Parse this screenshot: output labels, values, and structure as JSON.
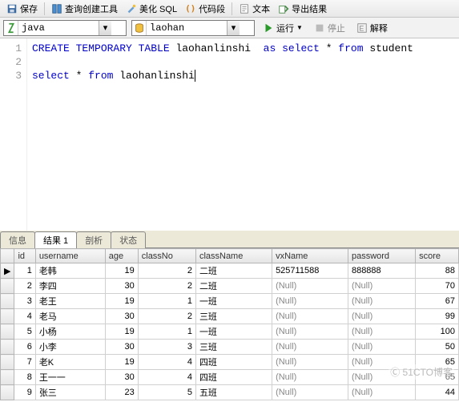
{
  "toolbar": {
    "save": "保存",
    "query_builder": "查询创建工具",
    "beautify": "美化 SQL",
    "snippet": "代码段",
    "text": "文本",
    "export": "导出结果"
  },
  "selectors": {
    "conn": "java",
    "db": "laohan",
    "run": "运行",
    "stop": "停止",
    "explain": "解释"
  },
  "code": {
    "lines": [
      {
        "n": "1",
        "parts": [
          {
            "t": "CREATE TEMPORARY TABLE",
            "c": "kw"
          },
          {
            "t": " laohanlinshi  ",
            "c": "id"
          },
          {
            "t": "as select",
            "c": "kw"
          },
          {
            "t": " * ",
            "c": "id"
          },
          {
            "t": "from",
            "c": "kw"
          },
          {
            "t": " student",
            "c": "id"
          }
        ]
      },
      {
        "n": "2",
        "parts": []
      },
      {
        "n": "3",
        "parts": [
          {
            "t": "select",
            "c": "kw"
          },
          {
            "t": " * ",
            "c": "id"
          },
          {
            "t": "from",
            "c": "kw"
          },
          {
            "t": " laohanlinshi",
            "c": "id"
          }
        ],
        "cursor": true
      }
    ]
  },
  "tabs": {
    "info": "信息",
    "result": "结果 1",
    "profile": "剖析",
    "status": "状态"
  },
  "grid": {
    "headers": [
      "id",
      "username",
      "age",
      "classNo",
      "className",
      "vxName",
      "password",
      "score"
    ],
    "rows": [
      {
        "id": 1,
        "username": "老韩",
        "age": 19,
        "classNo": 2,
        "className": "二班",
        "vxName": "525711588",
        "password": "888888",
        "score": 88
      },
      {
        "id": 2,
        "username": "李四",
        "age": 30,
        "classNo": 2,
        "className": "二班",
        "vxName": null,
        "password": null,
        "score": 70
      },
      {
        "id": 3,
        "username": "老王",
        "age": 19,
        "classNo": 1,
        "className": "一班",
        "vxName": null,
        "password": null,
        "score": 67
      },
      {
        "id": 4,
        "username": "老马",
        "age": 30,
        "classNo": 2,
        "className": "三班",
        "vxName": null,
        "password": null,
        "score": 99
      },
      {
        "id": 5,
        "username": "小杨",
        "age": 19,
        "classNo": 1,
        "className": "一班",
        "vxName": null,
        "password": null,
        "score": 100
      },
      {
        "id": 6,
        "username": "小李",
        "age": 30,
        "classNo": 3,
        "className": "三班",
        "vxName": null,
        "password": null,
        "score": 50
      },
      {
        "id": 7,
        "username": "老K",
        "age": 19,
        "classNo": 4,
        "className": "四班",
        "vxName": null,
        "password": null,
        "score": 65
      },
      {
        "id": 8,
        "username": "王一一",
        "age": 30,
        "classNo": 4,
        "className": "四班",
        "vxName": null,
        "password": null,
        "score": 65
      },
      {
        "id": 9,
        "username": "张三",
        "age": 23,
        "classNo": 5,
        "className": "五班",
        "vxName": null,
        "password": null,
        "score": 44
      }
    ],
    "null_label": "(Null)"
  },
  "watermark": "Ⓒ 51CTO博客"
}
